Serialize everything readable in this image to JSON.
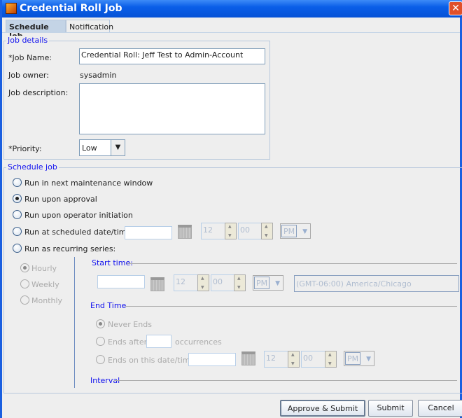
{
  "window": {
    "title": "Credential Roll Job",
    "close": "✕"
  },
  "tabs": [
    {
      "label": "Schedule Job",
      "selected": true
    },
    {
      "label": "Notification",
      "selected": false
    }
  ],
  "job_details": {
    "legend": "Job details",
    "job_name_label": "*Job Name:",
    "job_name_value": "Credential Roll: Jeff Test to Admin-Account",
    "owner_label": "Job owner:",
    "owner_value": "sysadmin",
    "description_label": "Job description:",
    "description_value": "",
    "priority_label": "*Priority:",
    "priority_value": "Low"
  },
  "schedule": {
    "legend": "Schedule job",
    "options": [
      {
        "label": "Run in next maintenance window",
        "selected": false
      },
      {
        "label": "Run upon approval",
        "selected": true
      },
      {
        "label": "Run upon operator initiation",
        "selected": false
      },
      {
        "label": "Run at scheduled date/time:",
        "selected": false
      },
      {
        "label": "Run as recurring series:",
        "selected": false
      }
    ],
    "scheduled": {
      "date": "",
      "hour": "12",
      "minute": "00",
      "ampm": "PM"
    },
    "recurrence": [
      {
        "label": "Hourly",
        "selected": true
      },
      {
        "label": "Weekly",
        "selected": false
      },
      {
        "label": "Monthly",
        "selected": false
      }
    ],
    "start_time": {
      "legend": "Start time:",
      "date": "",
      "hour": "12",
      "minute": "00",
      "ampm": "PM",
      "timezone": "(GMT-06:00) America/Chicago"
    },
    "end_time": {
      "legend": "End Time",
      "never": "Never Ends",
      "after": "Ends after",
      "occurrences": "occurrences",
      "on_date": "Ends on this date/time",
      "hour": "12",
      "minute": "00",
      "ampm": "PM"
    },
    "interval": {
      "legend": "Interval"
    }
  },
  "buttons": {
    "approve": "Approve & Submit",
    "submit": "Submit",
    "cancel": "Cancel"
  }
}
